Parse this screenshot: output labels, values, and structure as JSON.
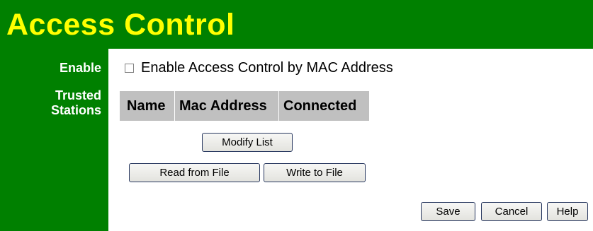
{
  "page": {
    "title": "Access Control"
  },
  "colors": {
    "header_bg": "#008000",
    "title_text": "#ffff00",
    "table_header_bg": "#c0c0c0"
  },
  "sidebar": {
    "enable_label": "Enable",
    "trusted_label_line1": "Trusted",
    "trusted_label_line2": "Stations"
  },
  "enable": {
    "checkbox_label": "Enable Access Control by MAC Address",
    "checked": false
  },
  "trusted_table": {
    "columns": [
      "Name",
      "Mac Address",
      "Connected"
    ],
    "rows": []
  },
  "buttons": {
    "modify_list": "Modify List",
    "read_from_file": "Read from File",
    "write_to_file": "Write to File",
    "save": "Save",
    "cancel": "Cancel",
    "help": "Help"
  }
}
